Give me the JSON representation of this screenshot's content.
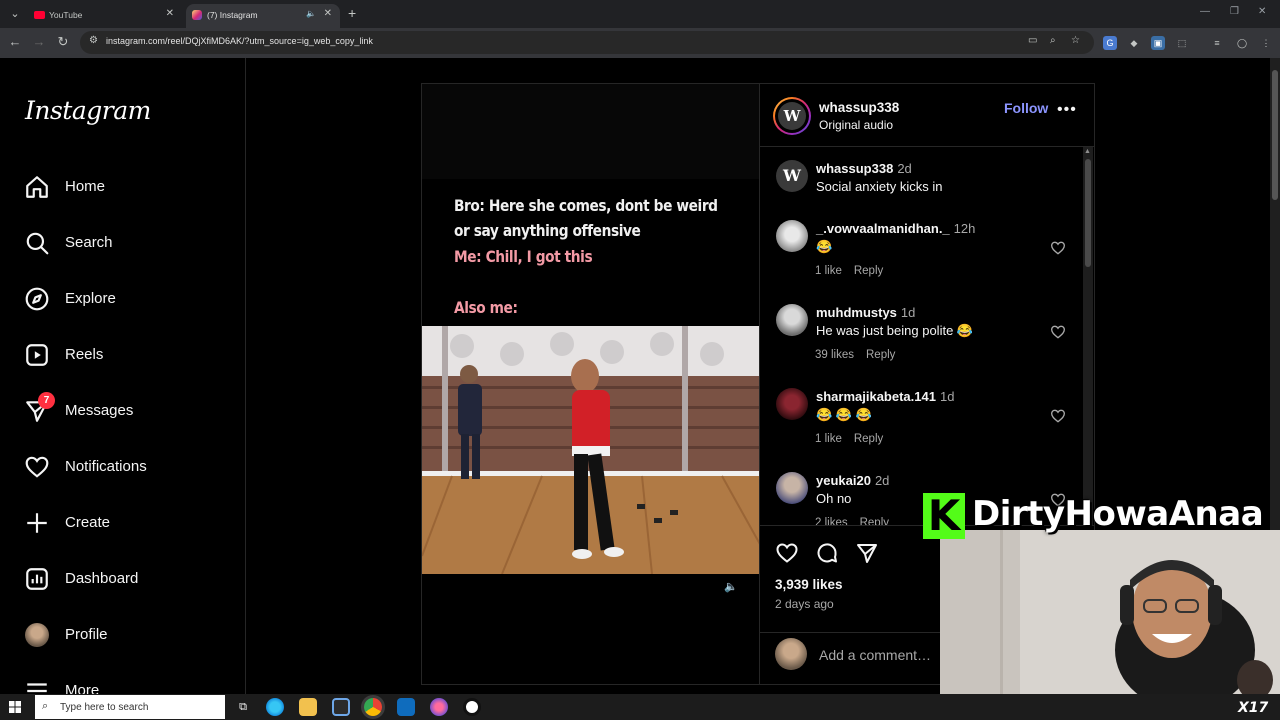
{
  "browser": {
    "tabs": [
      {
        "title": "YouTube"
      },
      {
        "title": "(7) Instagram"
      }
    ],
    "url": "instagram.com/reel/DQjXfiMD6AK/?utm_source=ig_web_copy_link"
  },
  "sidebar": {
    "logo": "Instagram",
    "items": [
      {
        "label": "Home",
        "icon": "home-icon"
      },
      {
        "label": "Search",
        "icon": "search-icon"
      },
      {
        "label": "Explore",
        "icon": "compass-icon"
      },
      {
        "label": "Reels",
        "icon": "reels-icon"
      },
      {
        "label": "Messages",
        "icon": "messenger-icon",
        "badge": "7"
      },
      {
        "label": "Notifications",
        "icon": "heart-icon"
      },
      {
        "label": "Create",
        "icon": "plus-icon"
      },
      {
        "label": "Dashboard",
        "icon": "dashboard-icon"
      },
      {
        "label": "Profile",
        "icon": "profile-avatar"
      },
      {
        "label": "More",
        "icon": "menu-icon"
      }
    ]
  },
  "reel": {
    "caption_line1": "Bro: Here she comes, dont be weird",
    "caption_line2": "or say anything offensive",
    "caption_line3": "Me: Chill, I got this",
    "caption_line4": "Also me:"
  },
  "post": {
    "username": "whassup338",
    "audio": "Original audio",
    "follow_label": "Follow",
    "likes": "3,939 likes",
    "date": "2 days ago",
    "add_comment_placeholder": "Add a comment…"
  },
  "comments": [
    {
      "user": "whassup338",
      "time": "2d",
      "text": "Social anxiety kicks in",
      "likes": "",
      "reply": ""
    },
    {
      "user": "_.vowvaalmanidhan._",
      "time": "12h",
      "text": "😂",
      "likes": "1 like",
      "reply": "Reply"
    },
    {
      "user": "muhdmustys",
      "time": "1d",
      "text": "He was just being polite 😂",
      "likes": "39 likes",
      "reply": "Reply"
    },
    {
      "user": "sharmajikabeta.141",
      "time": "1d",
      "text": "😂 😂 😂",
      "likes": "1 like",
      "reply": "Reply"
    },
    {
      "user": "yeukai20",
      "time": "2d",
      "text": "Oh no",
      "likes": "2 likes",
      "reply": "Reply"
    }
  ],
  "overlay": {
    "streamer_name": "DirtyHowaAnaa",
    "platform_badge": "K",
    "corner_logo": "X17"
  },
  "taskbar": {
    "search_placeholder": "Type here to search"
  },
  "colors": {
    "instagram_blue": "#8c95ff",
    "notification_red": "#ff3040",
    "kick_green": "#53fc18"
  }
}
